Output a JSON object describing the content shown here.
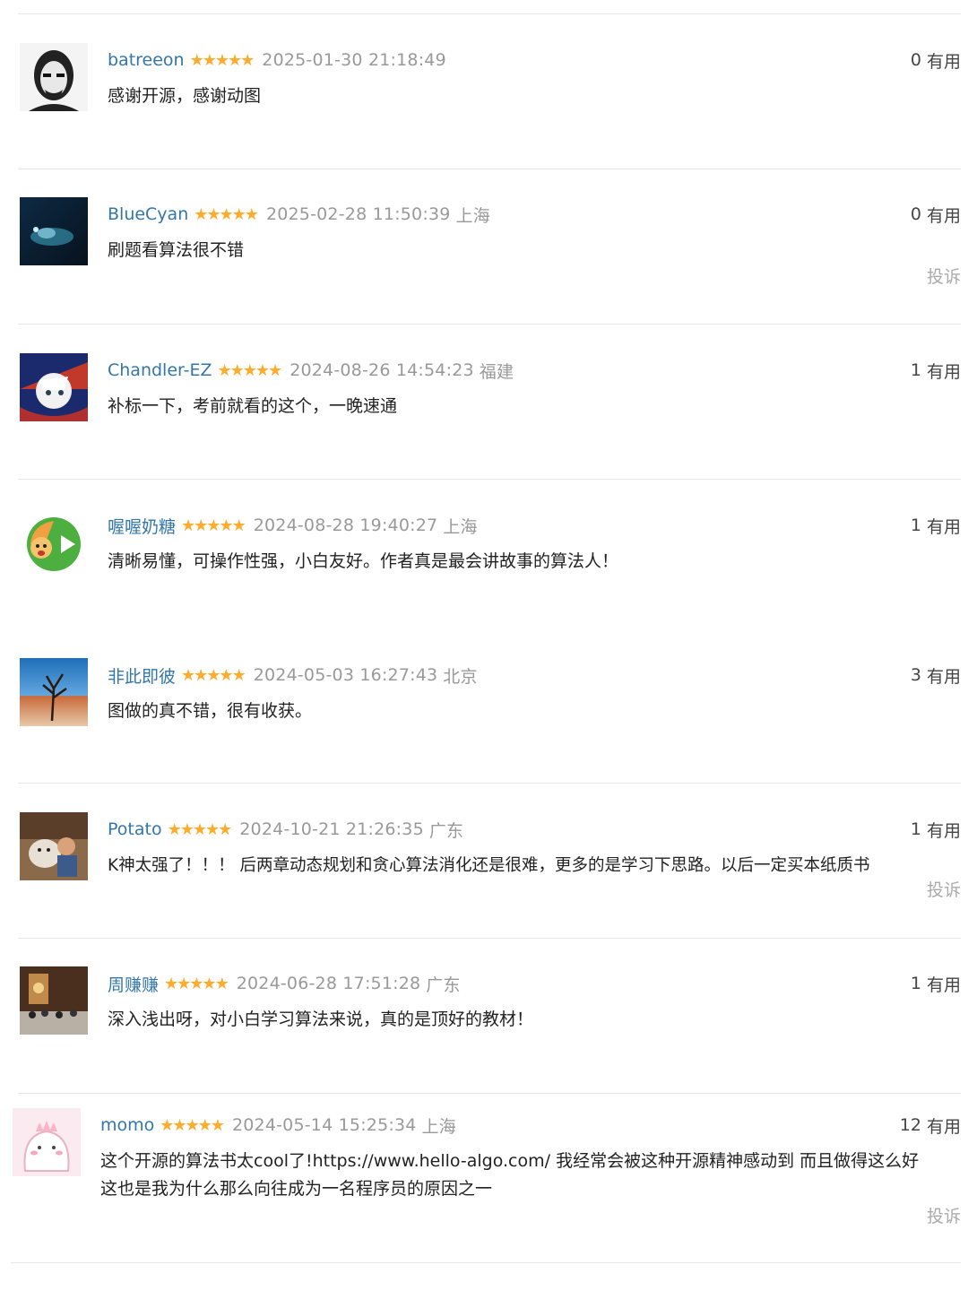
{
  "useful_label": "有用",
  "report_label": "投诉",
  "comments": [
    {
      "user": "batreeon",
      "stars": "★★★★★",
      "time": "2025-01-30 21:18:49",
      "location": "",
      "useful": "0",
      "text": "感谢开源，感谢动图"
    },
    {
      "user": "BlueCyan",
      "stars": "★★★★★",
      "time": "2025-02-28 11:50:39",
      "location": "上海",
      "useful": "0",
      "text": "刷题看算法很不错"
    },
    {
      "user": "Chandler-EZ",
      "stars": "★★★★★",
      "time": "2024-08-26 14:54:23",
      "location": "福建",
      "useful": "1",
      "text": "补标一下，考前就看的这个，一晚速通"
    },
    {
      "user": "喔喔奶糖",
      "stars": "★★★★★",
      "time": "2024-08-28 19:40:27",
      "location": "上海",
      "useful": "1",
      "text": "清晰易懂，可操作性强，小白友好。作者真是最会讲故事的算法人！"
    },
    {
      "user": "非此即彼",
      "stars": "★★★★★",
      "time": "2024-05-03 16:27:43",
      "location": "北京",
      "useful": "3",
      "text": "图做的真不错，很有收获。"
    },
    {
      "user": "Potato",
      "stars": "★★★★★",
      "time": "2024-10-21 21:26:35",
      "location": "广东",
      "useful": "1",
      "text": "K神太强了！！！ 后两章动态规划和贪心算法消化还是很难，更多的是学习下思路。以后一定买本纸质书"
    },
    {
      "user": "周赚赚",
      "stars": "★★★★★",
      "time": "2024-06-28 17:51:28",
      "location": "广东",
      "useful": "1",
      "text": "深入浅出呀，对小白学习算法来说，真的是顶好的教材！"
    },
    {
      "user": "momo",
      "stars": "★★★★★",
      "time": "2024-05-14 15:25:34",
      "location": "上海",
      "useful": "12",
      "text": "这个开源的算法书太cool了!https://www.hello-algo.com/ 我经常会被这种开源精神感动到 而且做得这么好 这也是我为什么那么向往成为一名程序员的原因之一"
    }
  ]
}
